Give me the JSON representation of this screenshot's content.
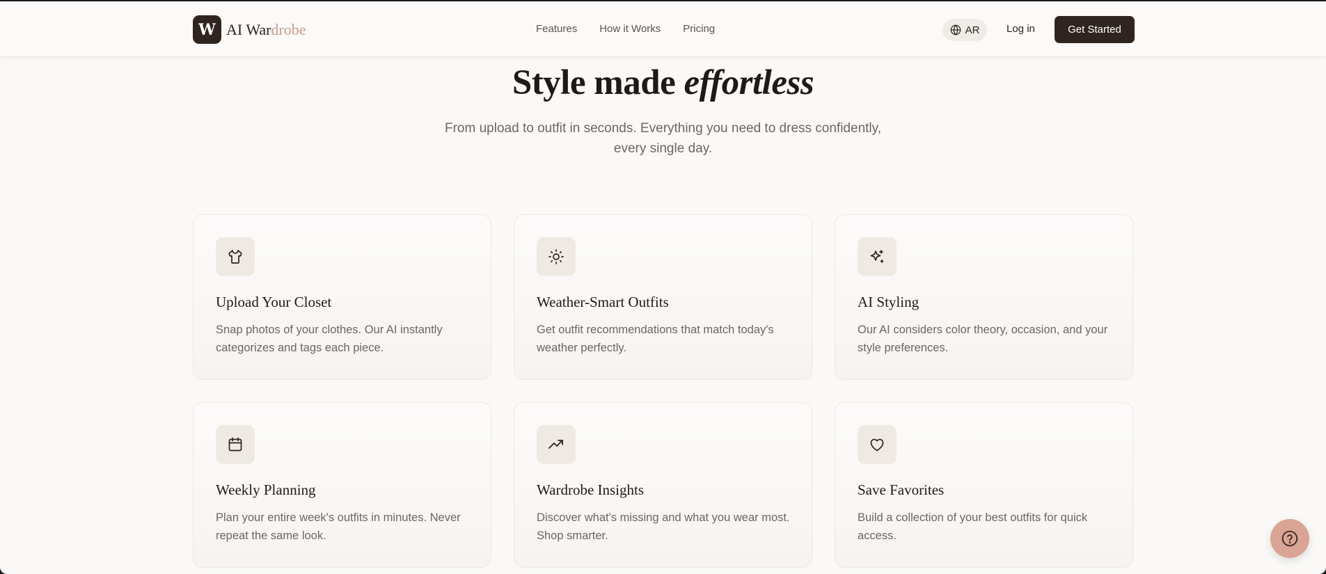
{
  "brand": {
    "mark": "W",
    "name_part1": "AI War",
    "name_part2": "drobe",
    "accent": "#c99a8a",
    "dark": "#2f241f"
  },
  "nav": {
    "items": [
      {
        "label": "Features"
      },
      {
        "label": "How it Works"
      },
      {
        "label": "Pricing"
      }
    ]
  },
  "header": {
    "language": "AR",
    "login": "Log in",
    "cta": "Get Started"
  },
  "hero": {
    "title_plain": "Style made ",
    "title_italic": "effortless",
    "subtitle": "From upload to outfit in seconds. Everything you need to dress confidently, every single day."
  },
  "features": [
    {
      "icon": "shirt-icon",
      "title": "Upload Your Closet",
      "description": "Snap photos of your clothes. Our AI instantly categorizes and tags each piece."
    },
    {
      "icon": "sun-icon",
      "title": "Weather-Smart Outfits",
      "description": "Get outfit recommendations that match today's weather perfectly."
    },
    {
      "icon": "sparkles-icon",
      "title": "AI Styling",
      "description": "Our AI considers color theory, occasion, and your style preferences."
    },
    {
      "icon": "calendar-icon",
      "title": "Weekly Planning",
      "description": "Plan your entire week's outfits in minutes. Never repeat the same look."
    },
    {
      "icon": "trending-up-icon",
      "title": "Wardrobe Insights",
      "description": "Discover what's missing and what you wear most. Shop smarter."
    },
    {
      "icon": "heart-icon",
      "title": "Save Favorites",
      "description": "Build a collection of your best outfits for quick access."
    }
  ],
  "help": {
    "icon": "help-circle-icon"
  }
}
